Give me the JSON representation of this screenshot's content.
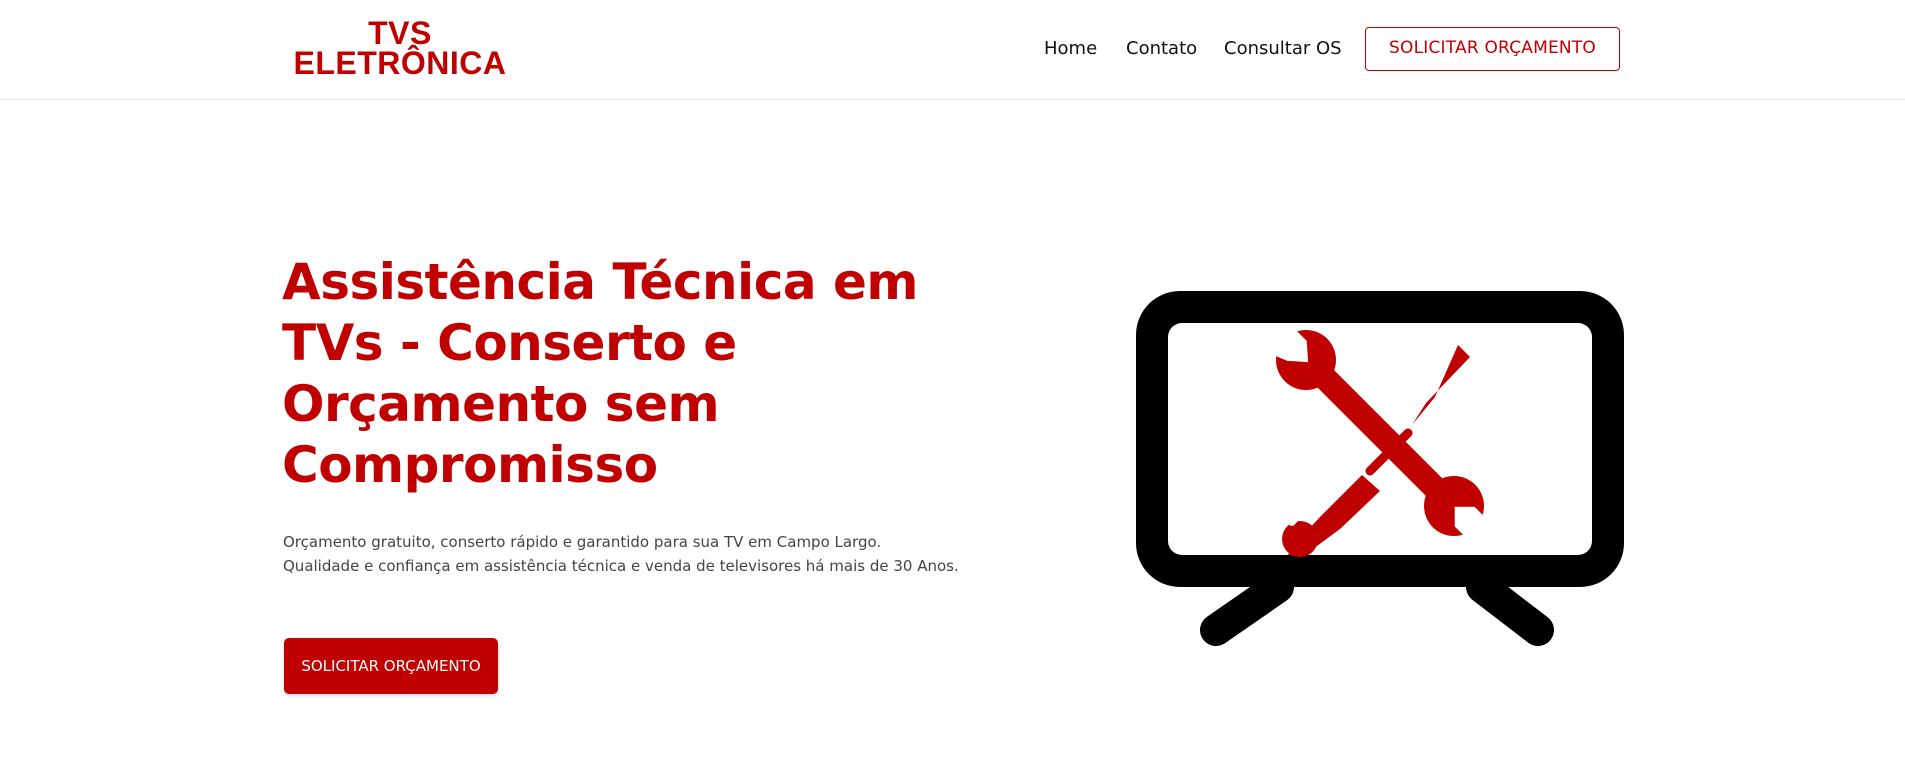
{
  "header": {
    "logo_line1": "TVS",
    "logo_line2": "ELETRÔNICA",
    "nav": [
      "Home",
      "Contato",
      "Consultar OS"
    ],
    "cta": "SOLICITAR ORÇAMENTO"
  },
  "hero": {
    "title": "Assistência Técnica em TVs - Conserto e Orçamento sem Compromisso",
    "text_line1": "Orçamento gratuito, conserto rápido e garantido para sua TV em Campo Largo.",
    "text_line2": "Qualidade e confiança em assistência técnica e venda de televisores há mais de 30 Anos.",
    "cta": "SOLICITAR ORÇAMENTO",
    "illustration": "tv-repair-icon"
  },
  "colors": {
    "brand": "#c00000",
    "text": "#111111",
    "muted": "#444444"
  }
}
